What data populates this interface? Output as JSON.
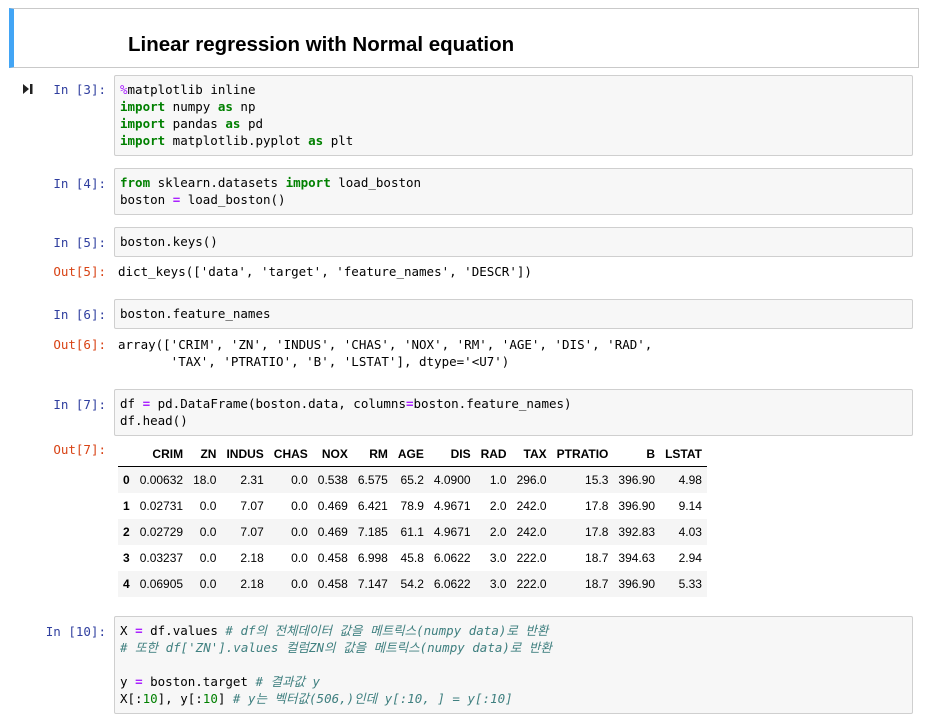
{
  "header": {
    "title": "Linear regression with Normal equation"
  },
  "cells": [
    {
      "prompt": "In [3]:",
      "lines": [
        [
          [
            "magic",
            "%"
          ],
          [
            "",
            "matplotlib inline"
          ]
        ],
        [
          [
            "kw",
            "import"
          ],
          [
            "",
            " numpy "
          ],
          [
            "kw",
            "as"
          ],
          [
            "",
            " np"
          ]
        ],
        [
          [
            "kw",
            "import"
          ],
          [
            "",
            " pandas "
          ],
          [
            "kw",
            "as"
          ],
          [
            "",
            " pd"
          ]
        ],
        [
          [
            "kw",
            "import"
          ],
          [
            "",
            " matplotlib.pyplot "
          ],
          [
            "kw",
            "as"
          ],
          [
            "",
            " plt"
          ]
        ]
      ]
    },
    {
      "prompt": "In [4]:",
      "lines": [
        [
          [
            "kw",
            "from"
          ],
          [
            "",
            " sklearn.datasets "
          ],
          [
            "kw",
            "import"
          ],
          [
            "",
            " load_boston"
          ]
        ],
        [
          [
            "",
            "boston "
          ],
          [
            "op",
            "="
          ],
          [
            "",
            " load_boston()"
          ]
        ]
      ]
    },
    {
      "prompt": "In [5]:",
      "lines": [
        [
          [
            "",
            "boston.keys()"
          ]
        ]
      ],
      "out_prompt": "Out[5]:",
      "out_lines": [
        "dict_keys(['data', 'target', 'feature_names', 'DESCR'])"
      ]
    },
    {
      "prompt": "In [6]:",
      "lines": [
        [
          [
            "",
            "boston.feature_names"
          ]
        ]
      ],
      "out_prompt": "Out[6]:",
      "out_lines": [
        "array(['CRIM', 'ZN', 'INDUS', 'CHAS', 'NOX', 'RM', 'AGE', 'DIS', 'RAD',",
        "       'TAX', 'PTRATIO', 'B', 'LSTAT'], dtype='<U7')"
      ]
    },
    {
      "prompt": "In [7]:",
      "lines": [
        [
          [
            "",
            "df "
          ],
          [
            "op",
            "="
          ],
          [
            "",
            " pd.DataFrame(boston.data, columns"
          ],
          [
            "op",
            "="
          ],
          [
            "",
            "boston.feature_names)"
          ]
        ],
        [
          [
            "",
            "df.head()"
          ]
        ]
      ],
      "out_prompt": "Out[7]:"
    },
    {
      "prompt": "In [10]:",
      "lines": [
        [
          [
            "",
            "X "
          ],
          [
            "op",
            "="
          ],
          [
            "",
            " df.values "
          ],
          [
            "cmt",
            "# df의 전체데이터 값을 메트릭스(numpy data)로 반환"
          ]
        ],
        [
          [
            "cmt",
            "# 또한 df['ZN'].values 컬럼ZN의 값을 메트릭스(numpy data)로 반환"
          ]
        ],
        [
          [
            "",
            ""
          ]
        ],
        [
          [
            "",
            "y "
          ],
          [
            "op",
            "="
          ],
          [
            "",
            " boston.target "
          ],
          [
            "cmt",
            "# 결과값 y"
          ]
        ],
        [
          [
            "",
            "X[:"
          ],
          [
            "num",
            "10"
          ],
          [
            "",
            "], y[:"
          ],
          [
            "num",
            "10"
          ],
          [
            "",
            "] "
          ],
          [
            "cmt",
            "# y는 벡터값(506,)인데 y[:10, ] = y[:10]"
          ]
        ]
      ]
    }
  ],
  "dataframe": {
    "columns": [
      "",
      "CRIM",
      "ZN",
      "INDUS",
      "CHAS",
      "NOX",
      "RM",
      "AGE",
      "DIS",
      "RAD",
      "TAX",
      "PTRATIO",
      "B",
      "LSTAT"
    ],
    "rows": [
      [
        "0",
        "0.00632",
        "18.0",
        "2.31",
        "0.0",
        "0.538",
        "6.575",
        "65.2",
        "4.0900",
        "1.0",
        "296.0",
        "15.3",
        "396.90",
        "4.98"
      ],
      [
        "1",
        "0.02731",
        "0.0",
        "7.07",
        "0.0",
        "0.469",
        "6.421",
        "78.9",
        "4.9671",
        "2.0",
        "242.0",
        "17.8",
        "396.90",
        "9.14"
      ],
      [
        "2",
        "0.02729",
        "0.0",
        "7.07",
        "0.0",
        "0.469",
        "7.185",
        "61.1",
        "4.9671",
        "2.0",
        "242.0",
        "17.8",
        "392.83",
        "4.03"
      ],
      [
        "3",
        "0.03237",
        "0.0",
        "2.18",
        "0.0",
        "0.458",
        "6.998",
        "45.8",
        "6.0622",
        "3.0",
        "222.0",
        "18.7",
        "394.63",
        "2.94"
      ],
      [
        "4",
        "0.06905",
        "0.0",
        "2.18",
        "0.0",
        "0.458",
        "7.147",
        "54.2",
        "6.0622",
        "3.0",
        "222.0",
        "18.7",
        "396.90",
        "5.33"
      ]
    ]
  },
  "colors": {
    "accent": "#42a5f5",
    "in_prompt": "#303f9f",
    "out_prompt": "#d84315",
    "keyword": "#008000",
    "comment": "#408080"
  },
  "icons": {
    "run": "run-cell-icon"
  }
}
